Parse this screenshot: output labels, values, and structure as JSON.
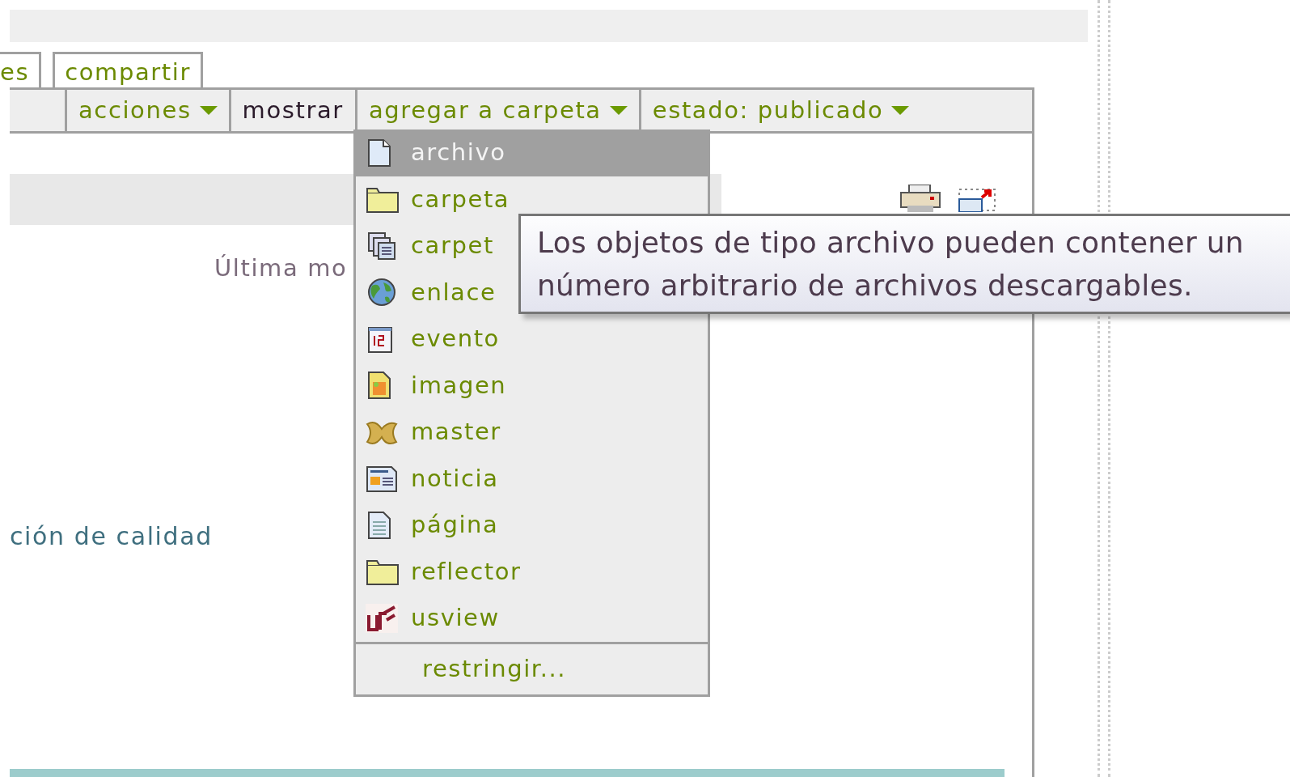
{
  "tabs": [
    {
      "label": "es",
      "selected": false
    },
    {
      "label": "compartir",
      "selected": false
    }
  ],
  "actions": [
    {
      "label": "acciones",
      "dropdown": true,
      "active": false
    },
    {
      "label": "mostrar",
      "dropdown": false,
      "active": true
    },
    {
      "label": "agregar a carpeta",
      "dropdown": true,
      "active": false
    },
    {
      "label": "estado: publicado",
      "dropdown": true,
      "active": false
    }
  ],
  "modified_text": "Última mo",
  "body_text": "ción de calidad",
  "add_menu": {
    "items": [
      {
        "label": "archivo",
        "kind": "file",
        "selected": true
      },
      {
        "label": "carpeta",
        "kind": "folder",
        "selected": false
      },
      {
        "label": "carpet",
        "kind": "stack",
        "selected": false
      },
      {
        "label": "enlace",
        "kind": "globe",
        "selected": false
      },
      {
        "label": "evento",
        "kind": "calendar",
        "selected": false
      },
      {
        "label": "imagen",
        "kind": "image",
        "selected": false
      },
      {
        "label": "master",
        "kind": "puzzle",
        "selected": false
      },
      {
        "label": "noticia",
        "kind": "news",
        "selected": false
      },
      {
        "label": "página",
        "kind": "page",
        "selected": false
      },
      {
        "label": "reflector",
        "kind": "folder",
        "selected": false
      },
      {
        "label": "usview",
        "kind": "logo",
        "selected": false
      }
    ],
    "footer": "restringir..."
  },
  "tooltip": "Los objetos de tipo archivo pueden contener un número arbitrario de archivos descargables."
}
